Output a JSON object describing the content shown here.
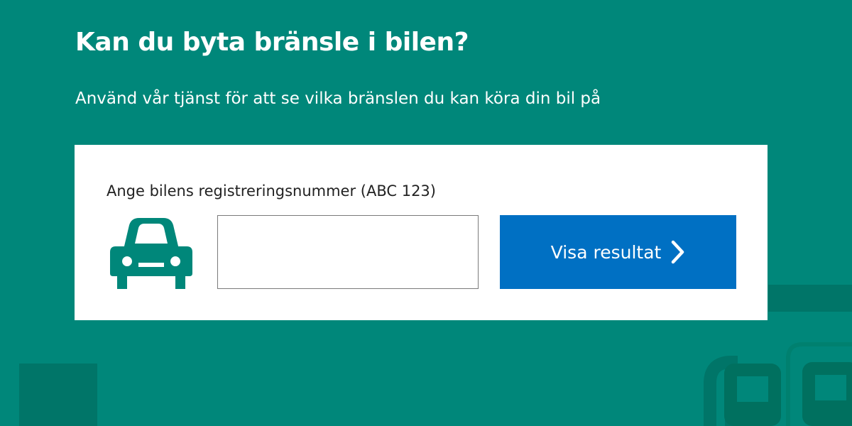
{
  "header": {
    "title": "Kan du byta bränsle i bilen?",
    "subtitle": "Använd vår tjänst för att se vilka bränslen du kan köra din bil på"
  },
  "lookup": {
    "label": "Ange bilens registreringsnummer (ABC 123)",
    "input_value": "",
    "input_placeholder": "",
    "button_label": "Visa resultat",
    "icons": {
      "vehicle": "car-icon",
      "button": "chevron-right-icon",
      "background": "fuel-pump-icon"
    }
  },
  "colors": {
    "background": "#00877a",
    "background_accent": "#007568",
    "card": "#ffffff",
    "button": "#0070c3",
    "car_icon": "#00877a"
  }
}
